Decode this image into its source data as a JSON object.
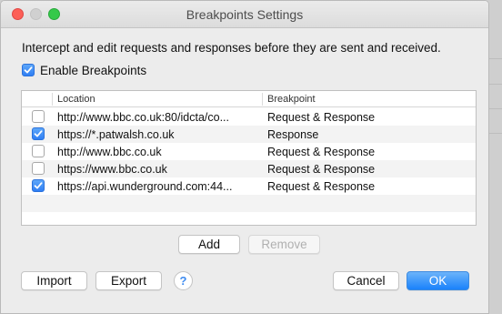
{
  "window": {
    "title": "Breakpoints Settings"
  },
  "intro_text": "Intercept and edit requests and responses before they are sent and received.",
  "enable": {
    "label": "Enable Breakpoints",
    "checked": true
  },
  "table": {
    "columns": [
      "Location",
      "Breakpoint"
    ],
    "rows": [
      {
        "checked": false,
        "location": "http://www.bbc.co.uk:80/idcta/co...",
        "breakpoint": "Request & Response"
      },
      {
        "checked": true,
        "location": "https://*.patwalsh.co.uk",
        "breakpoint": "Response"
      },
      {
        "checked": false,
        "location": "http://www.bbc.co.uk",
        "breakpoint": "Request & Response"
      },
      {
        "checked": false,
        "location": "https://www.bbc.co.uk",
        "breakpoint": "Request & Response"
      },
      {
        "checked": true,
        "location": "https://api.wunderground.com:44...",
        "breakpoint": "Request & Response"
      }
    ]
  },
  "buttons": {
    "add": "Add",
    "remove": "Remove",
    "import": "Import",
    "export": "Export",
    "help": "?",
    "cancel": "Cancel",
    "ok": "OK"
  },
  "colors": {
    "accent": "#2f7ef4",
    "close": "#fc5f57",
    "zoom": "#35c94a"
  },
  "icons": {
    "check": "checkmark-icon",
    "help": "question-mark-icon"
  }
}
